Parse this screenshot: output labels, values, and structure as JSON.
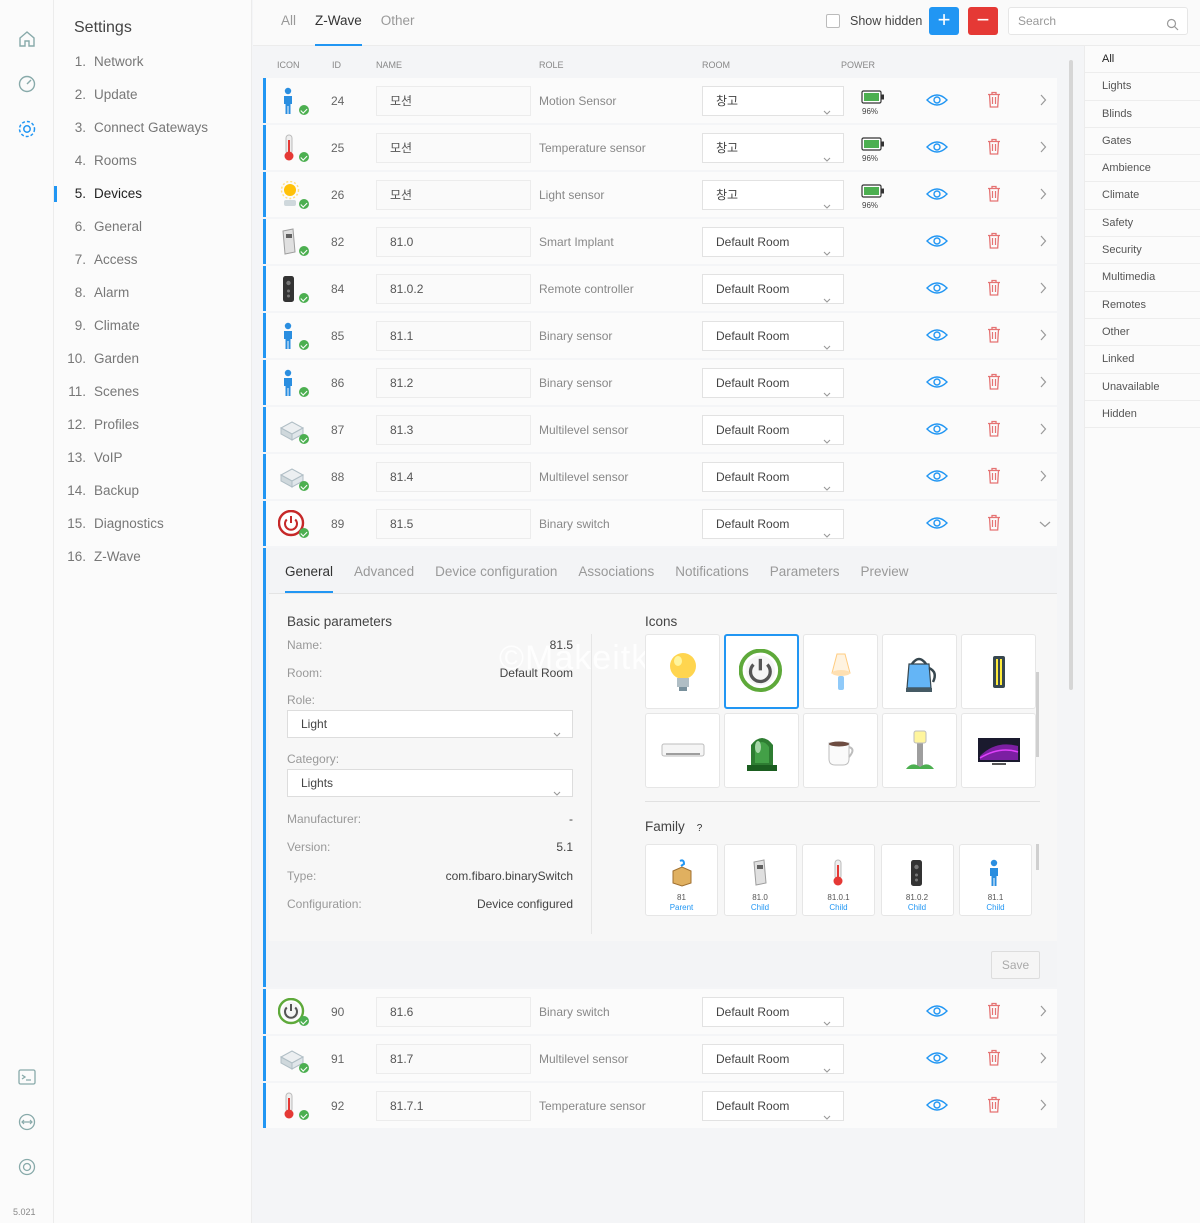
{
  "version": "5.021",
  "sidebar": {
    "title": "Settings",
    "items": [
      {
        "num": "1.",
        "label": "Network"
      },
      {
        "num": "2.",
        "label": "Update"
      },
      {
        "num": "3.",
        "label": "Connect Gateways"
      },
      {
        "num": "4.",
        "label": "Rooms"
      },
      {
        "num": "5.",
        "label": "Devices",
        "active": true
      },
      {
        "num": "6.",
        "label": "General"
      },
      {
        "num": "7.",
        "label": "Access"
      },
      {
        "num": "8.",
        "label": "Alarm"
      },
      {
        "num": "9.",
        "label": "Climate"
      },
      {
        "num": "10.",
        "label": "Garden"
      },
      {
        "num": "11.",
        "label": "Scenes"
      },
      {
        "num": "12.",
        "label": "Profiles"
      },
      {
        "num": "13.",
        "label": "VoIP"
      },
      {
        "num": "14.",
        "label": "Backup"
      },
      {
        "num": "15.",
        "label": "Diagnostics"
      },
      {
        "num": "16.",
        "label": "Z-Wave"
      }
    ]
  },
  "topbar": {
    "tabs": [
      "All",
      "Z-Wave",
      "Other"
    ],
    "active_tab": "Z-Wave",
    "show_hidden_label": "Show hidden",
    "add_label": "+",
    "remove_label": "−",
    "search_placeholder": "Search"
  },
  "categories": [
    "All",
    "Lights",
    "Blinds",
    "Gates",
    "Ambience",
    "Climate",
    "Safety",
    "Security",
    "Multimedia",
    "Remotes",
    "Other",
    "Linked",
    "Unavailable",
    "Hidden"
  ],
  "table": {
    "headers": {
      "icon": "ICON",
      "id": "ID",
      "name": "NAME",
      "role": "ROLE",
      "room": "ROOM",
      "power": "POWER"
    },
    "rows_top": [
      {
        "icon": "person",
        "id": "24",
        "name": "모션",
        "role": "Motion Sensor",
        "room": "창고",
        "battery": "96%"
      },
      {
        "icon": "thermometer",
        "id": "25",
        "name": "모션",
        "role": "Temperature sensor",
        "room": "창고",
        "battery": "96%"
      },
      {
        "icon": "sun",
        "id": "26",
        "name": "모션",
        "role": "Light sensor",
        "room": "창고",
        "battery": "96%"
      },
      {
        "icon": "implant",
        "id": "82",
        "name": "81.0",
        "role": "Smart Implant",
        "room": "Default Room"
      },
      {
        "icon": "remote",
        "id": "84",
        "name": "81.0.2",
        "role": "Remote controller",
        "room": "Default Room"
      },
      {
        "icon": "person",
        "id": "85",
        "name": "81.1",
        "role": "Binary sensor",
        "room": "Default Room"
      },
      {
        "icon": "person",
        "id": "86",
        "name": "81.2",
        "role": "Binary sensor",
        "room": "Default Room"
      },
      {
        "icon": "multi",
        "id": "87",
        "name": "81.3",
        "role": "Multilevel sensor",
        "room": "Default Room"
      },
      {
        "icon": "multi",
        "id": "88",
        "name": "81.4",
        "role": "Multilevel sensor",
        "room": "Default Room"
      },
      {
        "icon": "power-red",
        "id": "89",
        "name": "81.5",
        "role": "Binary switch",
        "room": "Default Room",
        "expanded": true
      }
    ],
    "rows_bottom": [
      {
        "icon": "power-green",
        "id": "90",
        "name": "81.6",
        "role": "Binary switch",
        "room": "Default Room"
      },
      {
        "icon": "multi",
        "id": "91",
        "name": "81.7",
        "role": "Multilevel sensor",
        "room": "Default Room"
      },
      {
        "icon": "thermometer",
        "id": "92",
        "name": "81.7.1",
        "role": "Temperature sensor",
        "room": "Default Room"
      }
    ]
  },
  "detail": {
    "tabs": [
      "General",
      "Advanced",
      "Device configuration",
      "Associations",
      "Notifications",
      "Parameters",
      "Preview"
    ],
    "active_tab": "General",
    "watermark": "©Makeitkm",
    "basic": {
      "title": "Basic parameters",
      "name_label": "Name:",
      "name_value": "81.5",
      "room_label": "Room:",
      "room_value": "Default Room",
      "role_label": "Role:",
      "role_value": "Light",
      "category_label": "Category:",
      "category_value": "Lights",
      "manufacturer_label": "Manufacturer:",
      "manufacturer_value": "-",
      "version_label": "Version:",
      "version_value": "5.1",
      "type_label": "Type:",
      "type_value": "com.fibaro.binarySwitch",
      "configuration_label": "Configuration:",
      "configuration_value": "Device configured"
    },
    "icons_title": "Icons",
    "icons": [
      "bulb",
      "power-green",
      "lamp",
      "kettle",
      "tube-light",
      "aircon",
      "siren",
      "coffee",
      "garden-light",
      "tv"
    ],
    "selected_icon": "power-green",
    "family_title": "Family",
    "family_help": "?",
    "family": [
      {
        "icon": "box",
        "id": "81",
        "role": "Parent"
      },
      {
        "icon": "implant",
        "id": "81.0",
        "role": "Child"
      },
      {
        "icon": "thermometer",
        "id": "81.0.1",
        "role": "Child"
      },
      {
        "icon": "remote",
        "id": "81.0.2",
        "role": "Child"
      },
      {
        "icon": "person",
        "id": "81.1",
        "role": "Child"
      }
    ],
    "save_label": "Save"
  },
  "colors": {
    "accent": "#2196f3",
    "danger": "#e53935",
    "ok": "#4caf50",
    "battery": "#4caf50"
  }
}
